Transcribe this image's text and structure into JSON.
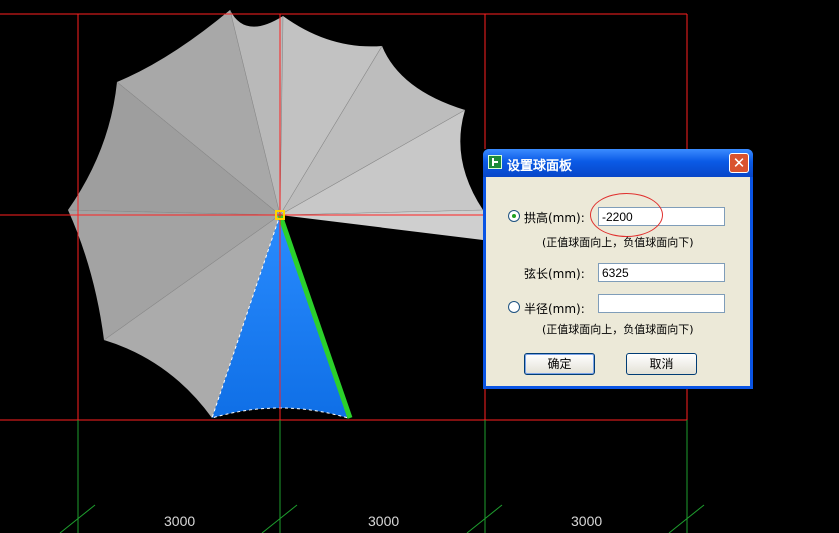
{
  "drawing": {
    "dimensions": [
      "3000",
      "3000",
      "3000"
    ],
    "colors": {
      "grid_red": "#ff2020",
      "grid_green": "#1e9e2e",
      "selected_panel": "#1a86ff",
      "selected_edge": "#2bd12b"
    }
  },
  "dialog": {
    "title": "设置球面板",
    "close_icon": "✕",
    "arch_height": {
      "label": "拱高(mm):",
      "value": "-2200",
      "selected": true
    },
    "arch_note": "(正值球面向上，负值球面向下)",
    "chord": {
      "label": "弦长(mm):",
      "value": "6325"
    },
    "radius": {
      "label": "半径(mm):",
      "value": "",
      "selected": false
    },
    "radius_note": "(正值球面向上，负值球面向下)",
    "ok_label": "确定",
    "cancel_label": "取消"
  }
}
